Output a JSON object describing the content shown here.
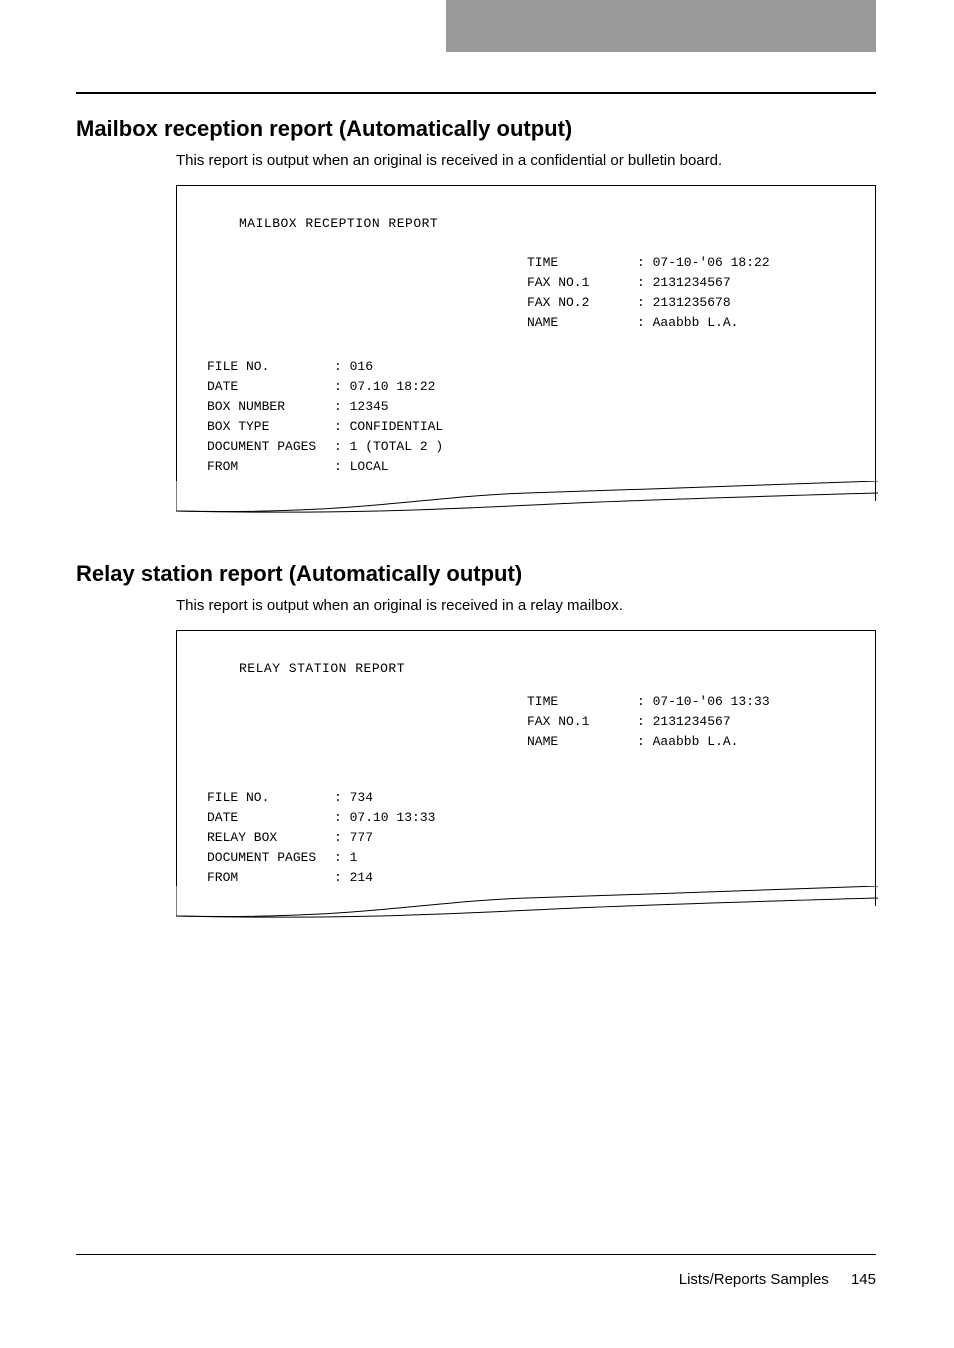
{
  "footer": {
    "breadcrumb": "Lists/Reports Samples",
    "page": "145"
  },
  "section1": {
    "heading": "Mailbox reception report (Automatically output)",
    "desc": "This report is output when an original is received in a confidential or bulletin board.",
    "report": {
      "title": "MAILBOX RECEPTION REPORT",
      "header": [
        {
          "label": "TIME",
          "value": ": 07-10-'06 18:22"
        },
        {
          "label": "FAX NO.1",
          "value": ": 2131234567"
        },
        {
          "label": "FAX NO.2",
          "value": ": 2131235678"
        },
        {
          "label": "NAME",
          "value": ": Aaabbb L.A."
        }
      ],
      "details": [
        {
          "label": "FILE NO.",
          "value": ": 016"
        },
        {
          "label": "DATE",
          "value": ": 07.10 18:22"
        },
        {
          "label": "BOX NUMBER",
          "value": ": 12345"
        },
        {
          "label": "BOX TYPE",
          "value": ": CONFIDENTIAL"
        },
        {
          "label": "DOCUMENT PAGES",
          "value": ": 1  (TOTAL 2 )"
        },
        {
          "label": "FROM",
          "value": ": LOCAL"
        }
      ]
    }
  },
  "section2": {
    "heading": "Relay station report (Automatically output)",
    "desc": "This report is output when an original is received in a relay mailbox.",
    "report": {
      "title": "RELAY STATION REPORT",
      "header": [
        {
          "label": "TIME",
          "value": ": 07-10-'06 13:33"
        },
        {
          "label": "FAX NO.1",
          "value": ": 2131234567"
        },
        {
          "label": "NAME",
          "value": ": Aaabbb L.A."
        }
      ],
      "details": [
        {
          "label": "FILE NO.",
          "value": ": 734"
        },
        {
          "label": "DATE",
          "value": ": 07.10 13:33"
        },
        {
          "label": "RELAY BOX",
          "value": ": 777"
        },
        {
          "label": "DOCUMENT PAGES",
          "value": ": 1"
        },
        {
          "label": "FROM",
          "value": ": 214"
        }
      ]
    }
  }
}
